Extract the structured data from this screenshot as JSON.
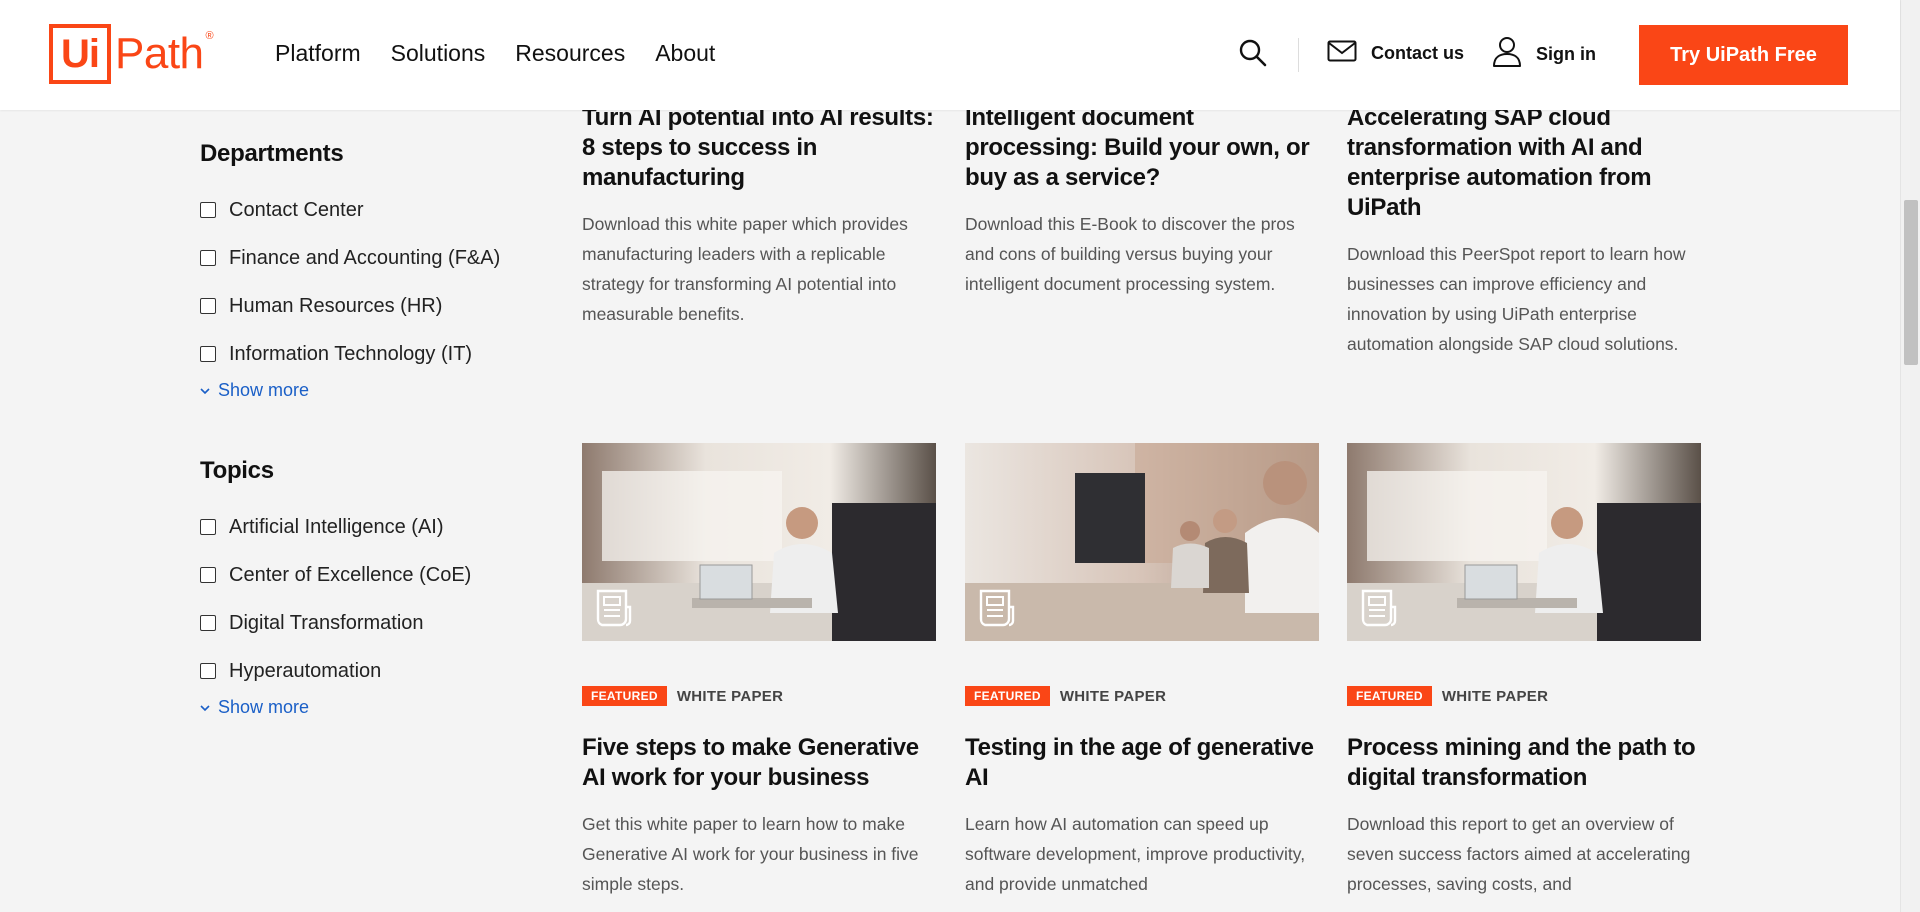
{
  "header": {
    "logo_box": "Ui",
    "logo_text": "Path",
    "logo_reg": "®",
    "nav": [
      "Platform",
      "Solutions",
      "Resources",
      "About"
    ],
    "contact_label": "Contact us",
    "signin_label": "Sign in",
    "cta_label": "Try UiPath Free",
    "brand_color": "#fa4616"
  },
  "sidebar": {
    "departments": {
      "title": "Departments",
      "options": [
        "Contact Center",
        "Finance and Accounting (F&A)",
        "Human Resources (HR)",
        "Information Technology (IT)"
      ],
      "show_more": "Show more"
    },
    "topics": {
      "title": "Topics",
      "options": [
        "Artificial Intelligence (AI)",
        "Center of Excellence (CoE)",
        "Digital Transformation",
        "Hyperautomation"
      ],
      "show_more": "Show more"
    }
  },
  "cards_top": [
    {
      "title": "Turn AI potential into AI results: 8 steps to success in manufacturing",
      "desc": "Download this white paper which provides manufacturing leaders with a replicable strategy for transforming AI potential into measurable benefits."
    },
    {
      "title": "Intelligent document processing: Build your own, or buy as a service?",
      "desc": "Download this E-Book to discover the pros and cons of building versus buying your intelligent document processing system."
    },
    {
      "title": "Accelerating SAP cloud transformation with AI and enterprise automation from UiPath",
      "desc": "Download this PeerSpot report to learn how businesses can improve efficiency and innovation by using UiPath enterprise automation alongside SAP cloud solutions."
    }
  ],
  "cards_bottom": [
    {
      "badge": "FEATURED",
      "type": "WHITE PAPER",
      "title": "Five steps to make Generative AI work for your business",
      "desc": "Get this white paper to learn how to make Generative AI work for your business in five simple steps."
    },
    {
      "badge": "FEATURED",
      "type": "WHITE PAPER",
      "title": "Testing in the age of generative AI",
      "desc": "Learn how AI automation can speed up software development, improve productivity, and provide unmatched"
    },
    {
      "badge": "FEATURED",
      "type": "WHITE PAPER",
      "title": "Process mining and the path to digital transformation",
      "desc": "Download this report to get an overview of seven success factors aimed at accelerating processes, saving costs, and"
    }
  ]
}
